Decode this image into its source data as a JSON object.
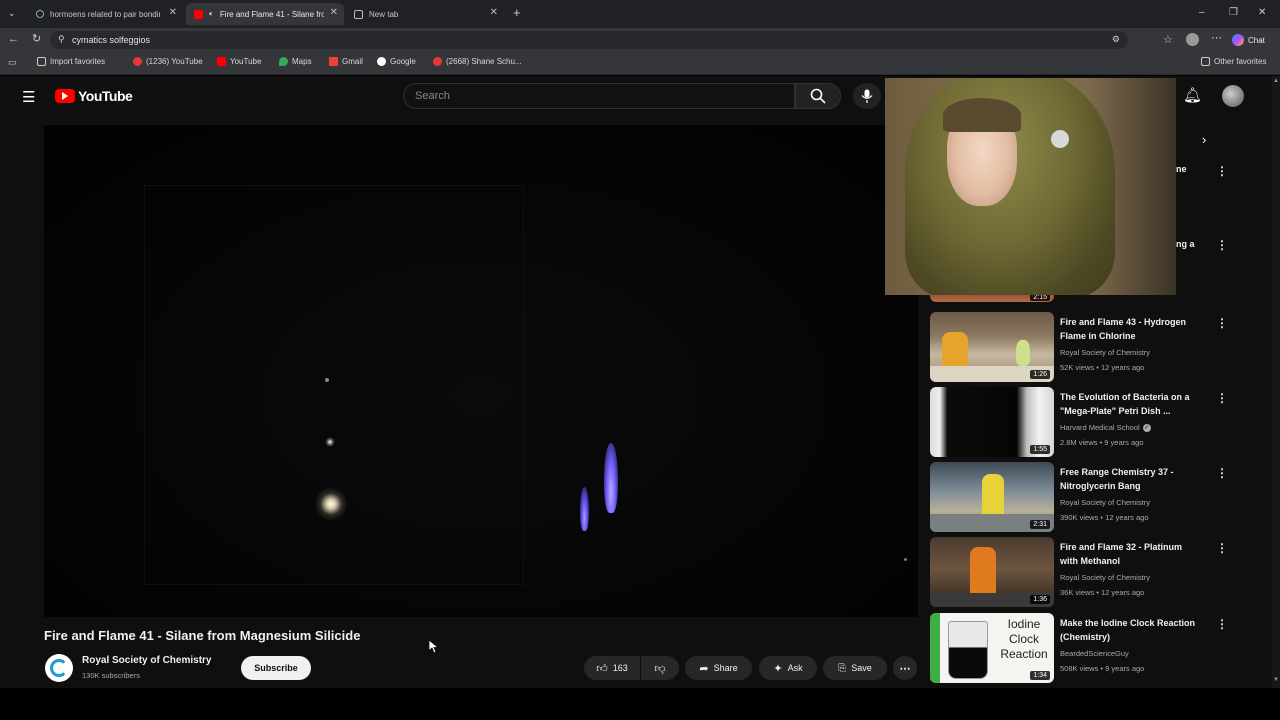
{
  "browser": {
    "tabs": [
      {
        "label": "hormoens related to pair bonding",
        "active": false
      },
      {
        "label": "Fire and Flame 41 - Silane fro",
        "active": true
      },
      {
        "label": "New tab",
        "active": false
      }
    ],
    "url": "cymatics solfeggios",
    "chat_label": "Chat",
    "bookmarks": [
      {
        "label": "Import favorites"
      },
      {
        "label": "(1236) YouTube"
      },
      {
        "label": "YouTube"
      },
      {
        "label": "Maps"
      },
      {
        "label": "Gmail"
      },
      {
        "label": "Google"
      },
      {
        "label": "(2668) Shane Schu..."
      }
    ],
    "other_favorites": "Other favorites"
  },
  "youtube": {
    "logo_text": "YouTube",
    "search_placeholder": "Search"
  },
  "video": {
    "title": "Fire and Flame 41 - Silane from Magnesium Silicide",
    "channel": "Royal Society of Chemistry",
    "subscribers": "130K subscribers",
    "subscribe_label": "Subscribe",
    "likes": "163",
    "share_label": "Share",
    "ask_label": "Ask",
    "save_label": "Save"
  },
  "partial_overlay": {
    "top_duration": "2:15",
    "cut_text_1": "ne",
    "cut_text_2": "ng a"
  },
  "recommendations": [
    {
      "title": "Fire and Flame 43 - Hydrogen Flame in Chlorine",
      "channel": "Royal Society of Chemistry",
      "meta": "52K views • 12 years ago",
      "duration": "1:26",
      "thumb": "lab"
    },
    {
      "title": "The Evolution of Bacteria on a \"Mega-Plate\" Petri Dish ...",
      "channel": "Harvard Medical School",
      "meta": "2.8M views • 9 years ago",
      "duration": "1:55",
      "thumb": "dark",
      "verified": true
    },
    {
      "title": "Free Range Chemistry 37 - Nitroglycerin Bang",
      "channel": "Royal Society of Chemistry",
      "meta": "390K views • 12 years ago",
      "duration": "2:31",
      "thumb": "lab2"
    },
    {
      "title": "Fire and Flame 32 - Platinum with Methanol",
      "channel": "Royal Society of Chemistry",
      "meta": "36K views • 12 years ago",
      "duration": "1:36",
      "thumb": "lab3"
    },
    {
      "title": "Make the Iodine Clock Reaction (Chemistry)",
      "channel": "BeardedScienceGuy",
      "meta": "508K views • 9 years ago",
      "duration": "1:34",
      "thumb": "iodine",
      "thumb_text": "Iodine Clock Reaction"
    }
  ],
  "colors": {
    "youtube_red": "#ff0000",
    "flame_blue": "#6f5cff",
    "page_bg": "#0f0f0f"
  }
}
